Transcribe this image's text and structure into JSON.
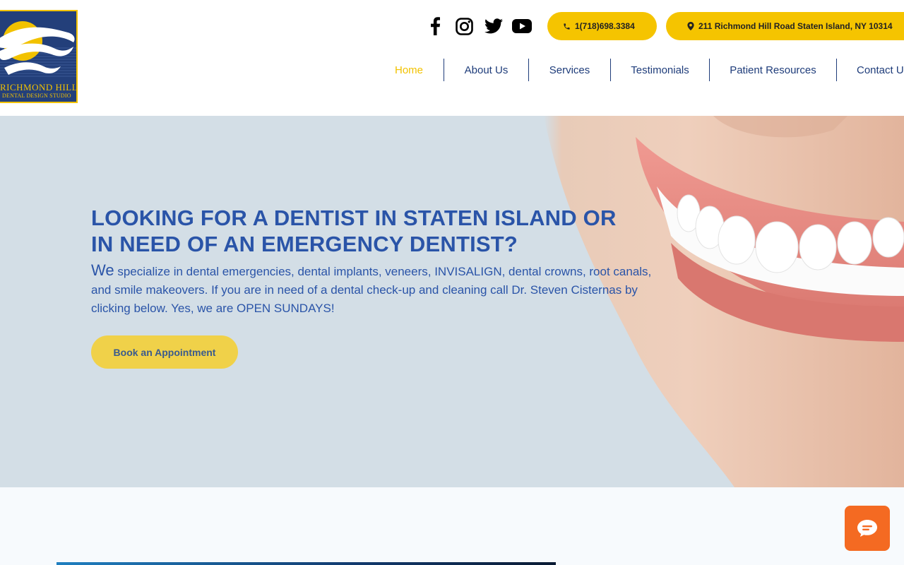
{
  "brand": {
    "line1": "RICHMOND HILL",
    "line2": "DENTAL DESIGN STUDIO",
    "colors": {
      "navy": "#233f7a",
      "gold": "#f2c200"
    }
  },
  "social": [
    {
      "name": "facebook-icon"
    },
    {
      "name": "instagram-icon"
    },
    {
      "name": "twitter-icon"
    },
    {
      "name": "youtube-icon"
    }
  ],
  "contact": {
    "phone": "1(718)698.3384",
    "address": "211 Richmond Hill Road Staten Island, NY 10314"
  },
  "nav": {
    "items": [
      "Home",
      "About Us",
      "Services",
      "Testimonials",
      "Patient Resources",
      "Contact Us"
    ],
    "active_color": "#f2c200",
    "color": "#1e3c7a"
  },
  "hero": {
    "title_line1": "LOOKING FOR A DENTIST IN STATEN ISLAND OR",
    "title_line2": "IN NEED OF AN EMERGENCY DENTIST?",
    "body_lead": "We",
    "body_rest": " specialize in dental emergencies, dental implants, veneers, INVISALIGN, dental crowns, root canals, and smile makeovers.  If you are in need of a dental check-up and cleaning call Dr. Steven Cisternas by clicking below. Yes, we are OPEN SUNDAYS!",
    "cta": "Book an Appointment",
    "accent": "#2a54a8",
    "cta_color": "#f0d149"
  },
  "chat": {
    "icon": "chat-bubble-icon",
    "color": "#f46a22"
  }
}
